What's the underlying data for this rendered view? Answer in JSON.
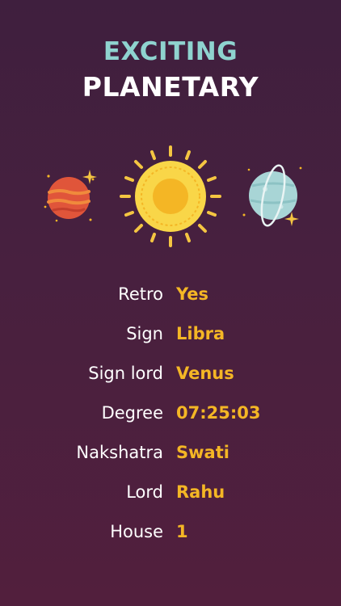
{
  "header": {
    "title_line1": "EXCITING",
    "title_line2": "PLANETARY"
  },
  "colors": {
    "title_accent": "#8fd3cf",
    "value_accent": "#f4b625",
    "background_top": "#3f1f3e",
    "background_bottom": "#521f3d"
  },
  "illustration": {
    "icons": [
      "mars-planet-icon",
      "sun-icon",
      "uranus-planet-icon",
      "sparkle-icon"
    ]
  },
  "details": [
    {
      "label": "Retro",
      "value": "Yes"
    },
    {
      "label": "Sign",
      "value": "Libra"
    },
    {
      "label": "Sign lord",
      "value": "Venus"
    },
    {
      "label": "Degree",
      "value": "07:25:03"
    },
    {
      "label": "Nakshatra",
      "value": "Swati"
    },
    {
      "label": "Lord",
      "value": "Rahu"
    },
    {
      "label": "House",
      "value": "1"
    }
  ]
}
